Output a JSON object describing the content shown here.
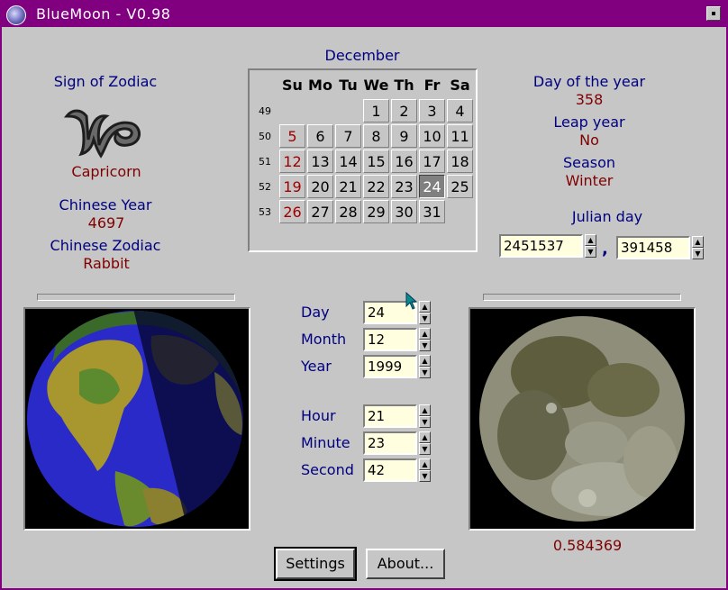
{
  "window": {
    "title": "BlueMoon - V0.98"
  },
  "zodiac": {
    "heading": "Sign of Zodiac",
    "sign": "Capricorn"
  },
  "chinese": {
    "year_label": "Chinese Year",
    "year": "4697",
    "zodiac_label": "Chinese Zodiac",
    "zodiac": "Rabbit"
  },
  "calendar": {
    "month": "December",
    "weekdays": [
      "Su",
      "Mo",
      "Tu",
      "We",
      "Th",
      "Fr",
      "Sa"
    ],
    "weeks": [
      "49",
      "50",
      "51",
      "52",
      "53"
    ],
    "selected_day": "24",
    "days": {
      "d1": "1",
      "d2": "2",
      "d3": "3",
      "d4": "4",
      "d5": "5",
      "d6": "6",
      "d7": "7",
      "d8": "8",
      "d9": "9",
      "d10": "10",
      "d11": "11",
      "d12": "12",
      "d13": "13",
      "d14": "14",
      "d15": "15",
      "d16": "16",
      "d17": "17",
      "d18": "18",
      "d19": "19",
      "d20": "20",
      "d21": "21",
      "d22": "22",
      "d23": "23",
      "d24": "24",
      "d25": "25",
      "d26": "26",
      "d27": "27",
      "d28": "28",
      "d29": "29",
      "d30": "30",
      "d31": "31"
    }
  },
  "info": {
    "day_of_year_label": "Day of the year",
    "day_of_year": "358",
    "leap_label": "Leap year",
    "leap": "No",
    "season_label": "Season",
    "season": "Winter",
    "julian_label": "Julian day",
    "julian_1": "2451537",
    "julian_2": "391458"
  },
  "date": {
    "day_label": "Day",
    "day": "24",
    "month_label": "Month",
    "month": "12",
    "year_label": "Year",
    "year": "1999"
  },
  "time": {
    "hour_label": "Hour",
    "hour": "21",
    "minute_label": "Minute",
    "minute": "23",
    "second_label": "Second",
    "second": "42"
  },
  "moon": {
    "phase": "0.584369"
  },
  "buttons": {
    "settings": "Settings",
    "about": "About..."
  },
  "colors": {
    "titlebar": "#800080",
    "label": "#000080",
    "value": "#800000",
    "background": "#c6c6c6"
  }
}
